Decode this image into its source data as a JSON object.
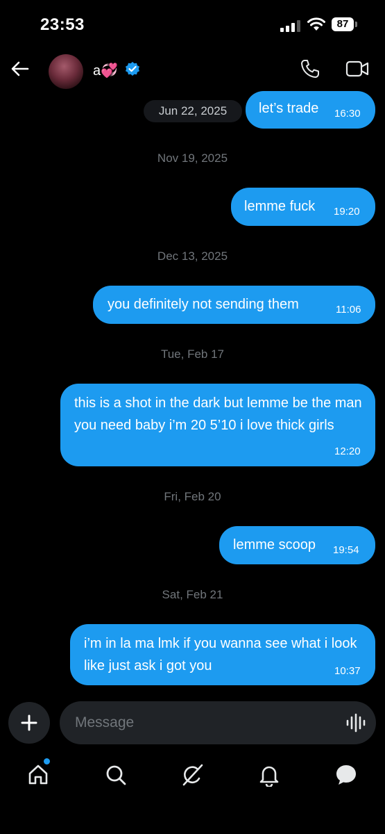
{
  "status_bar": {
    "time": "23:53",
    "battery": "87"
  },
  "header": {
    "contact_name": "a💞"
  },
  "messages": [
    {
      "text": "let’s trade",
      "time": "16:30"
    },
    {
      "text": "lemme fuck",
      "time": "19:20"
    },
    {
      "text": "you definitely not sending them",
      "time": "11:06"
    },
    {
      "text": "this is a shot in the dark but lemme be the man you need baby i’m 20 5’10 i love thick girls",
      "time": "12:20"
    },
    {
      "text": "lemme scoop",
      "time": "19:54"
    },
    {
      "text": "i’m in la ma lmk if you wanna see what i look like just ask i got you",
      "time": "10:37"
    }
  ],
  "dates": [
    "Jun 22, 2025",
    "Nov 19, 2025",
    "Dec 13, 2025",
    "Tue, Feb 17",
    "Fri, Feb 20",
    "Sat, Feb 21"
  ],
  "composer": {
    "placeholder": "Message"
  },
  "icons": {
    "back": "back-arrow-icon",
    "call": "phone-icon",
    "video": "video-icon",
    "plus": "plus-icon",
    "voice": "voice-wave-icon",
    "nav": [
      "home-icon",
      "search-icon",
      "grok-icon",
      "notifications-icon",
      "messages-icon"
    ]
  },
  "colors": {
    "accent": "#1d9bf0",
    "background": "#000000",
    "muted": "#71767b"
  }
}
